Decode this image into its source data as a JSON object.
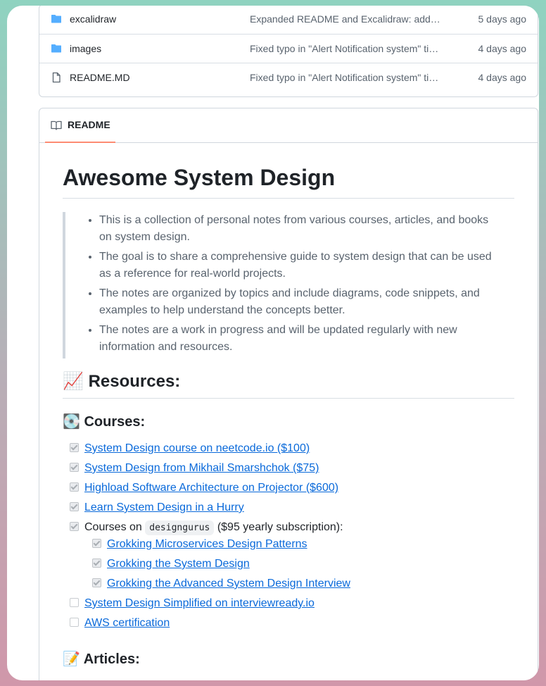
{
  "files": [
    {
      "name": "excalidraw",
      "type": "folder",
      "message": "Expanded README and Excalidraw: add…",
      "age": "5 days ago"
    },
    {
      "name": "images",
      "type": "folder",
      "message": "Fixed typo in \"Alert Notification system\" ti…",
      "age": "4 days ago"
    },
    {
      "name": "README.MD",
      "type": "file",
      "message": "Fixed typo in \"Alert Notification system\" ti…",
      "age": "4 days ago"
    }
  ],
  "readme": {
    "tab_label": "README",
    "title": "Awesome System Design",
    "intro": [
      "This is a collection of personal notes from various courses, articles, and books on system design.",
      "The goal is to share a comprehensive guide to system design that can be used as a reference for real-world projects.",
      "The notes are organized by topics and include diagrams, code snippets, and examples to help understand the concepts better.",
      "The notes are a work in progress and will be updated regularly with new information and resources."
    ],
    "resources_emoji": "📈",
    "resources_heading": "Resources:",
    "courses_emoji": "💽",
    "courses_heading": "Courses:",
    "courses": [
      {
        "label": "System Design course on neetcode.io ($100)",
        "checked": true
      },
      {
        "label": "System Design from Mikhail Smarshchok ($75)",
        "checked": true
      },
      {
        "label": "Highload Software Architecture on Projector ($600)",
        "checked": true
      },
      {
        "label": "Learn System Design in a Hurry",
        "checked": true
      }
    ],
    "courses_on": {
      "prefix": "Courses on",
      "code": "designgurus",
      "suffix": "($95 yearly subscription):",
      "checked": true
    },
    "designgurus_courses": [
      {
        "label": "Grokking Microservices Design Patterns",
        "checked": true
      },
      {
        "label": "Grokking the System Design",
        "checked": true
      },
      {
        "label": "Grokking the Advanced System Design Interview",
        "checked": true
      }
    ],
    "more_courses": [
      {
        "label": "System Design Simplified on interviewready.io",
        "checked": false
      },
      {
        "label": "AWS certification",
        "checked": false
      }
    ],
    "articles_emoji": "📝",
    "articles_heading": "Articles:"
  }
}
